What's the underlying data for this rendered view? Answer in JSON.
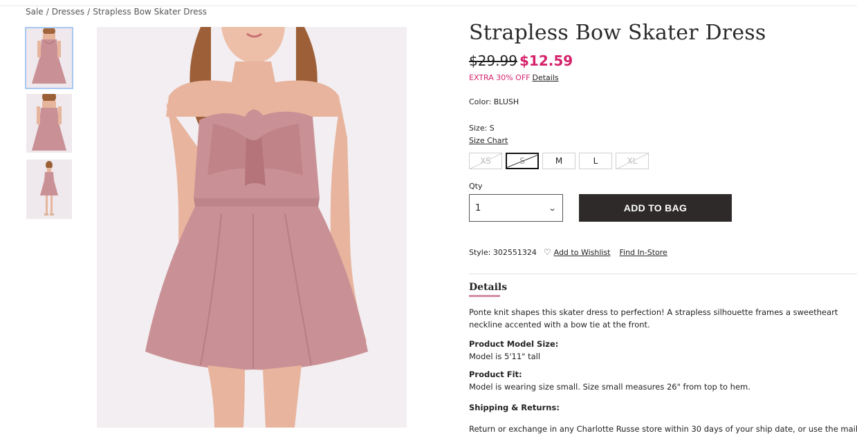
{
  "breadcrumb": {
    "items": [
      "Sale",
      "Dresses",
      "Strapless Bow Skater Dress"
    ],
    "separator": "/"
  },
  "product": {
    "title": "Strapless Bow Skater Dress",
    "old_price": "$29.99",
    "new_price": "$12.59",
    "promo_text": "EXTRA 30% OFF",
    "promo_link": "Details",
    "color_label": "Color:",
    "color_value": "BLUSH",
    "size_label": "Size:",
    "size_value": "S",
    "size_chart_label": "Size Chart",
    "sizes": [
      {
        "label": "XS",
        "available": false,
        "selected": false
      },
      {
        "label": "S",
        "available": false,
        "selected": true
      },
      {
        "label": "M",
        "available": true,
        "selected": false
      },
      {
        "label": "L",
        "available": true,
        "selected": false
      },
      {
        "label": "XL",
        "available": false,
        "selected": false
      }
    ],
    "qty_label": "Qty",
    "qty_value": "1",
    "add_to_bag_label": "ADD TO BAG",
    "style_label": "Style:",
    "style_value": "302551324",
    "wishlist_label": "Add to Wishlist",
    "find_in_store_label": "Find In-Store"
  },
  "details": {
    "heading": "Details",
    "description": "Ponte knit shapes this skater dress to perfection! A strapless silhouette frames a sweetheart neckline accented with a bow tie at the front.",
    "model_size_heading": "Product Model Size:",
    "model_size_text": "Model is 5'11\" tall",
    "fit_heading": "Product Fit:",
    "fit_text": "Model is wearing size small. Size small measures 26\" from top to hem.",
    "shipping_heading": "Shipping & Returns:",
    "shipping_text": "Return or exchange in any Charlotte Russe store within 30 days of your ship date, or use the mailing label"
  },
  "colors": {
    "accent": "#d4226b",
    "button_dark": "#2e2a2a",
    "dress": "#c99195",
    "tab_underline": "#d28aa2",
    "thumb_selected_border": "#a8c8f0"
  },
  "icons": {
    "heart": "heart-outline-icon",
    "chevron": "chevron-down-icon"
  }
}
